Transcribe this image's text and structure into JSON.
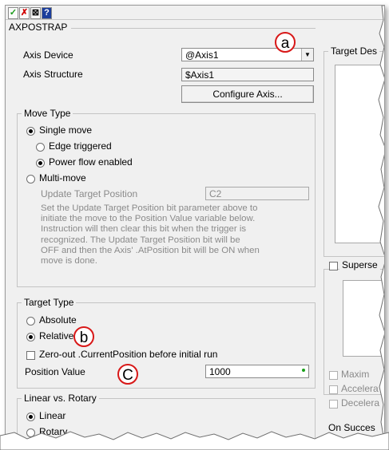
{
  "toolbar": {
    "accept_glyph": "✓",
    "cancel_glyph": "✗",
    "verify_glyph": "⊠",
    "help_glyph": "?",
    "icons": [
      "check-icon",
      "close-icon",
      "verify-icon",
      "help-icon"
    ]
  },
  "instruction": {
    "title": "AXPOSTRAP"
  },
  "axis": {
    "device_label": "Axis Device",
    "device_value": "@Axis1",
    "structure_label": "Axis Structure",
    "structure_value": "$Axis1",
    "configure_label": "Configure Axis..."
  },
  "move_type": {
    "legend": "Move Type",
    "single_move": "Single move",
    "edge_triggered": "Edge triggered",
    "power_flow": "Power flow enabled",
    "multi_move": "Multi-move",
    "update_target_label": "Update Target Position",
    "update_target_value": "C2",
    "description_lines": [
      "Set the Update Target Position bit parameter above to",
      "initiate the move to the Position Value variable below.",
      "Instruction will then clear this bit when the trigger is",
      "recognized.  The Update Target Position bit will be",
      "OFF and then the Axis' .AtPosition bit will be ON when",
      "move is done."
    ],
    "selected": "single_move",
    "sub_selected": "power_flow"
  },
  "target_type": {
    "legend": "Target Type",
    "absolute": "Absolute",
    "relative": "Relative",
    "selected": "relative",
    "zero_out_label": "Zero-out .CurrentPosition before initial run",
    "zero_out_checked": false,
    "position_label": "Position Value",
    "position_value": "1000"
  },
  "linear_rotary": {
    "legend": "Linear vs. Rotary",
    "linear": "Linear",
    "rotary": "Rotary",
    "selected": "linear"
  },
  "right_panel": {
    "target_desc_legend": "Target Des",
    "supersede_label": "Superse",
    "maximum_label": "Maxim",
    "acceleration_label": "Accelera",
    "deceleration_label": "Decelera",
    "on_success_label": "On Succes"
  },
  "callouts": {
    "a": "a",
    "b": "b",
    "c": "C"
  },
  "colors": {
    "callout_border": "#d81818",
    "check": "#1a9a1a",
    "close": "#d00000",
    "help_bg": "#1c3e9c"
  }
}
